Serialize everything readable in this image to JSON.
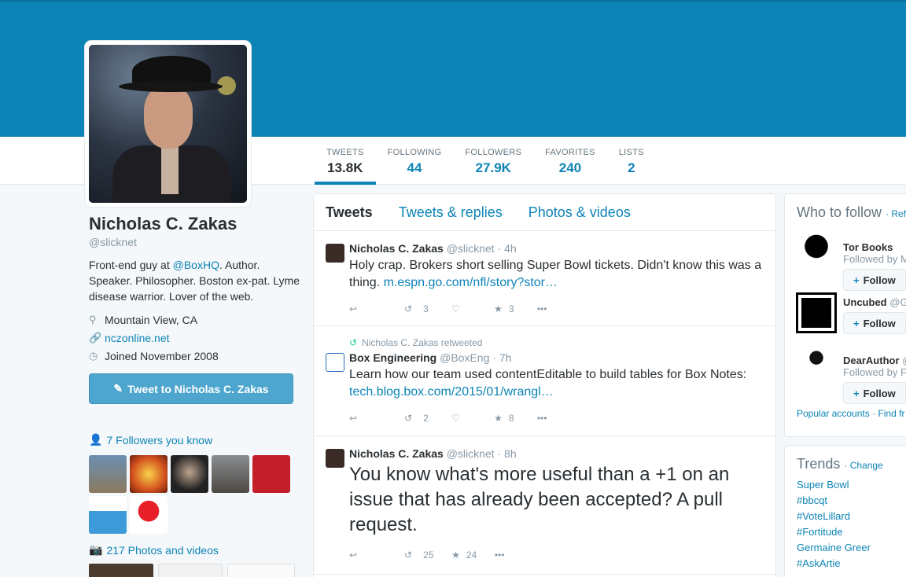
{
  "profile": {
    "name": "Nicholas C. Zakas",
    "handle": "@slicknet",
    "bio_1": "Front-end guy at ",
    "bio_link": "@BoxHQ",
    "bio_2": ". Author. Speaker. Philosopher. Boston ex-pat. Lyme disease warrior. Lover of the web.",
    "location": "Mountain View, CA",
    "website": "nczonline.net",
    "joined": "Joined November 2008",
    "tweet_to_label": "Tweet to Nicholas C. Zakas",
    "followers_you_know": "7 Followers you know",
    "photos_videos": "217 Photos and videos"
  },
  "stats": [
    {
      "label": "TWEETS",
      "value": "13.8K"
    },
    {
      "label": "FOLLOWING",
      "value": "44"
    },
    {
      "label": "FOLLOWERS",
      "value": "27.9K"
    },
    {
      "label": "FAVORITES",
      "value": "240"
    },
    {
      "label": "LISTS",
      "value": "2"
    }
  ],
  "timeline": {
    "tabs": [
      "Tweets",
      "Tweets & replies",
      "Photos & videos"
    ],
    "tweets": [
      {
        "name": "Nicholas C. Zakas",
        "handle": "@slicknet · 4h",
        "text": "Holy crap. Brokers short selling Super Bowl tickets. Didn't know this was a thing.",
        "link": "m.espn.go.com/nfl/story?stor…",
        "retweets": "3",
        "favorites": "3"
      },
      {
        "context": "Nicholas C. Zakas retweeted",
        "name": "Box Engineering",
        "handle": "@BoxEng · 7h",
        "text": "Learn how our team used contentEditable to build tables for Box Notes:",
        "link": "tech.blog.box.com/2015/01/wrangl…",
        "retweets": "2",
        "favorites": "8"
      },
      {
        "name": "Nicholas C. Zakas",
        "handle": "@slicknet · 8h",
        "text": "You know what's more useful than a +1 on an issue that has already been accepted? A pull request.",
        "retweets": "25",
        "favorites": "24"
      }
    ]
  },
  "who_to_follow": {
    "title": "Who to follow",
    "refresh": "· Refr",
    "accounts": [
      {
        "name": "Tor Books",
        "handle": "",
        "sub": "Followed by M"
      },
      {
        "name": "Uncubed",
        "handle": "@G",
        "sub": ""
      },
      {
        "name": "DearAuthor",
        "handle": "@",
        "sub": "Followed by F"
      }
    ],
    "follow_label": "Follow",
    "popular": "Popular accounts",
    "find": "· Find fr"
  },
  "trends": {
    "title": "Trends",
    "change": "· Change",
    "items": [
      "Super Bowl",
      "#bbcqt",
      "#VoteLillard",
      "#Fortitude",
      "Germaine Greer",
      "#AskArtie"
    ]
  },
  "colors": {
    "accent": "#0d84b6",
    "banner": "#0d84b6",
    "tweet_button": "#4ea6cf"
  }
}
